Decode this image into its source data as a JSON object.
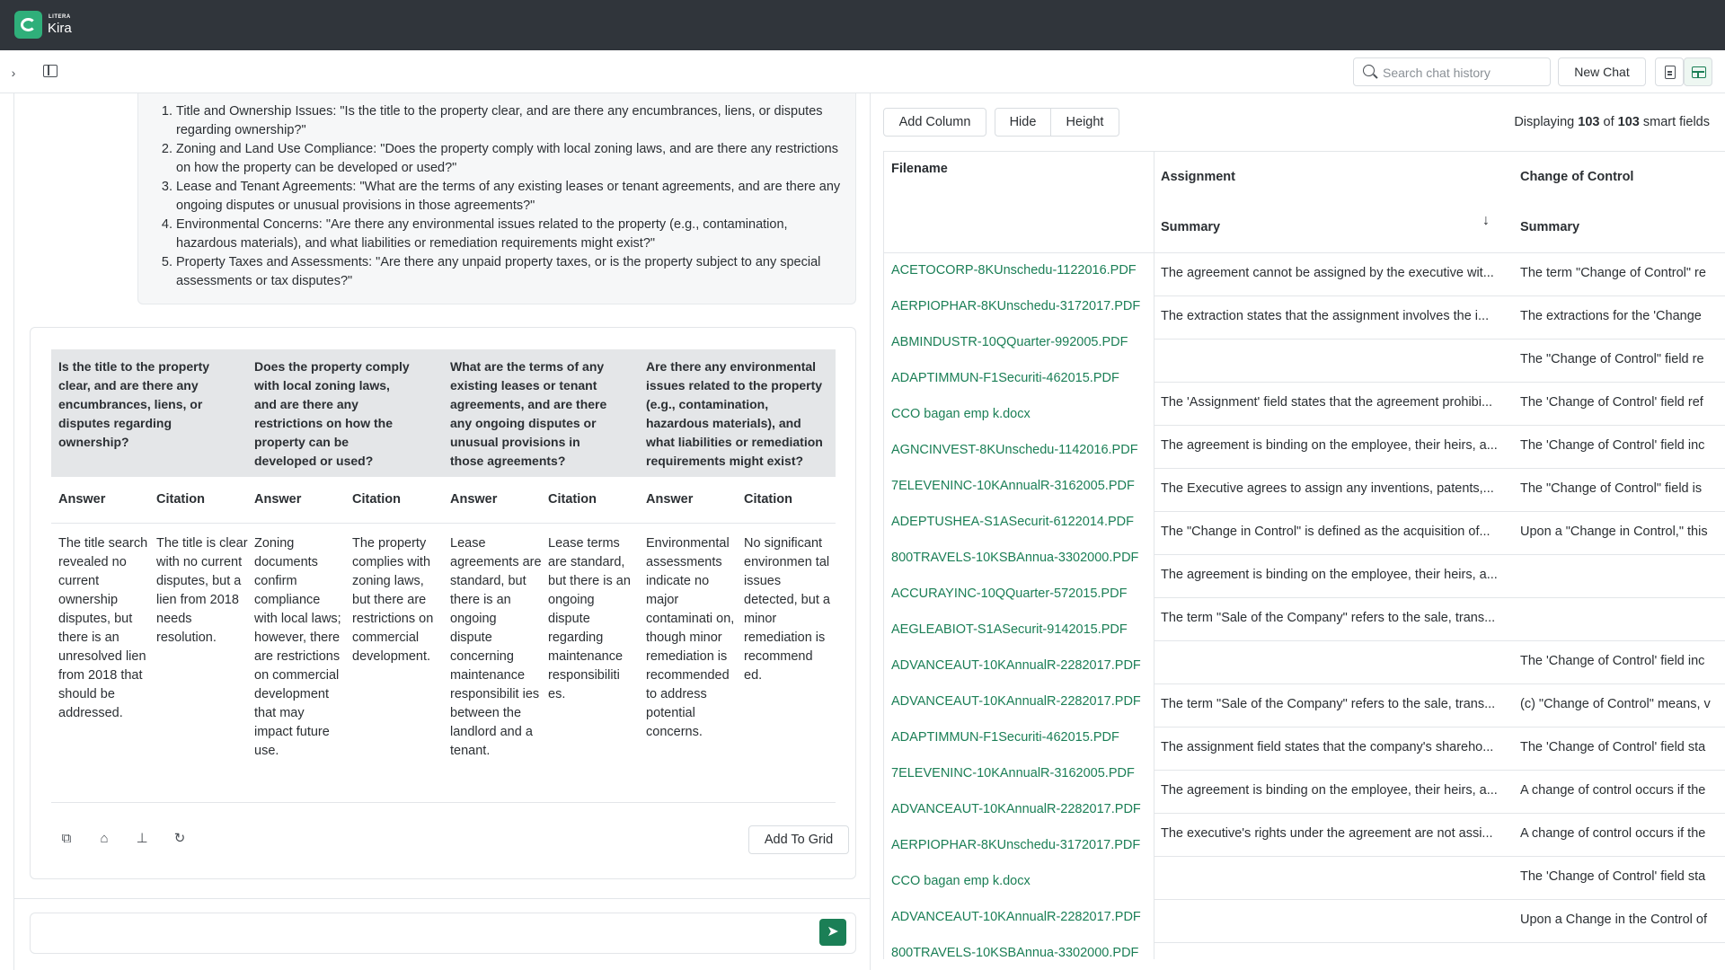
{
  "app": {
    "brand_small": "LITERA",
    "brand_name": "Kira"
  },
  "toolbar": {
    "search_placeholder": "Search chat history",
    "new_chat_label": "New Chat"
  },
  "questions": [
    "Title and Ownership Issues: \"Is the title to the property clear, and are there any encumbrances, liens, or disputes regarding ownership?\"",
    "Zoning and Land Use Compliance: \"Does the property comply with local zoning laws, and are there any restrictions on how the property can be developed or used?\"",
    "Lease and Tenant Agreements: \"What are the terms of any existing leases or tenant agreements, and are there any ongoing disputes or unusual provisions in those agreements?\"",
    "Environmental Concerns: \"Are there any environmental issues related to the property (e.g., contamination, hazardous materials), and what liabilities or remediation requirements might exist?\"",
    "Property Taxes and Assessments: \"Are there any unpaid property taxes, or is the property subject to any special assessments or tax disputes?\""
  ],
  "answer_grid": {
    "headers": [
      "Is the title to the property clear, and are there any encumbrances, liens, or disputes regarding ownership?",
      "Does the property comply with local zoning laws, and are there any restrictions on how the property can be developed or used?",
      "What are the terms of any existing leases or tenant agreements, and are there any ongoing disputes or unusual provisions in those agreements?",
      "Are there any environmental issues related to the property (e.g., contamination, hazardous materials), and what liabilities or remediation requirements might exist?"
    ],
    "answer_label": "Answer",
    "citation_label": "Citation",
    "cells": [
      "The title search revealed no current ownership disputes, but there is an unresolved lien from 2018 that should be addressed.",
      "The title is clear with no current disputes, but a lien from 2018 needs resolution.",
      "Zoning documents confirm compliance with local laws; however, there are restrictions on commercial development that may impact future use.",
      "The property complies with zoning laws, but there are restrictions on commercial development.",
      "Lease agreements are standard, but there is an ongoing dispute concerning maintenance responsibilit ies between the  landlord and a tenant.",
      "Lease terms are standard, but there is an ongoing dispute regarding maintenance responsibiliti es.",
      "Environmental assessments indicate no major contaminati on, though minor remediation is recommended to address potential concerns.",
      "No significant environmen tal issues detected, but a minor remediation is recommend ed."
    ],
    "add_to_grid_label": "Add To Grid"
  },
  "right_panel": {
    "add_column_label": "Add Column",
    "hide_label": "Hide",
    "height_label": "Height",
    "display_prefix": "Displaying",
    "display_shown": "103",
    "display_of": "of",
    "display_total": "103",
    "display_suffix": "smart fields",
    "columns": {
      "filename": "Filename",
      "assignment": "Assignment",
      "change_of_control": "Change of Control",
      "summary": "Summary"
    },
    "filenames": [
      "ACETOCORP-8KUnschedu-1122016.PDF",
      "AERPIOPHAR-8KUnschedu-3172017.PDF",
      "ABMINDUSTR-10QQuarter-992005.PDF",
      "ADAPTIMMUN-F1Securiti-462015.PDF",
      "CCO bagan emp k.docx",
      "AGNCINVEST-8KUnschedu-1142016.PDF",
      "7ELEVENINC-10KAnnualR-3162005.PDF",
      "ADEPTUSHEA-S1ASecurit-6122014.PDF",
      "800TRAVELS-10KSBAnnua-3302000.PDF",
      "ACCURAYINC-10QQuarter-572015.PDF",
      "AEGLEABIOT-S1ASecurit-9142015.PDF",
      "ADVANCEAUT-10KAnnualR-2282017.PDF",
      "ADVANCEAUT-10KAnnualR-2282017.PDF",
      "ADAPTIMMUN-F1Securiti-462015.PDF",
      "7ELEVENINC-10KAnnualR-3162005.PDF",
      "ADVANCEAUT-10KAnnualR-2282017.PDF",
      "AERPIOPHAR-8KUnschedu-3172017.PDF",
      "CCO bagan emp k.docx",
      "ADVANCEAUT-10KAnnualR-2282017.PDF",
      "800TRAVELS-10KSBAnnua-3302000.PDF"
    ],
    "summary_rows": [
      {
        "assignment": "The agreement cannot be assigned by the executive wit...",
        "control": "The term \"Change of Control\" re"
      },
      {
        "assignment": "The extraction states that the assignment involves the i...",
        "control": "The extractions for the 'Change"
      },
      {
        "assignment": "",
        "control": "The \"Change of Control\" field re"
      },
      {
        "assignment": "The 'Assignment' field states that the agreement prohibi...",
        "control": "The 'Change of Control' field ref"
      },
      {
        "assignment": "The agreement is binding on the employee, their heirs, a...",
        "control": "The 'Change of Control' field inc"
      },
      {
        "assignment": "The Executive agrees to assign any inventions, patents,...",
        "control": "The \"Change of Control\" field is"
      },
      {
        "assignment": "The \"Change in Control\" is defined as the acquisition of...",
        "control": "Upon a \"Change in Control,\" this"
      },
      {
        "assignment": "The agreement is binding on the employee, their heirs, a...",
        "control": ""
      },
      {
        "assignment": "The term \"Sale of the Company\" refers to the sale, trans...",
        "control": ""
      },
      {
        "assignment": "",
        "control": "The 'Change of Control' field inc"
      },
      {
        "assignment": "The term \"Sale of the Company\" refers to the sale, trans...",
        "control": "(c) \"Change of Control\" means, v"
      },
      {
        "assignment": "The assignment field states that the company's shareho...",
        "control": "The 'Change of Control' field sta"
      },
      {
        "assignment": "The agreement is binding on the employee, their heirs, a...",
        "control": "A change of control occurs if the"
      },
      {
        "assignment": "The executive's rights under the agreement are not assi...",
        "control": "A change of control occurs if the"
      },
      {
        "assignment": "",
        "control": "The 'Change of Control' field sta"
      },
      {
        "assignment": "",
        "control": "Upon a Change in the Control of"
      }
    ]
  },
  "colors": {
    "accent": "#1b7f56",
    "topbar": "#30353b",
    "logo": "#2faf7a"
  }
}
